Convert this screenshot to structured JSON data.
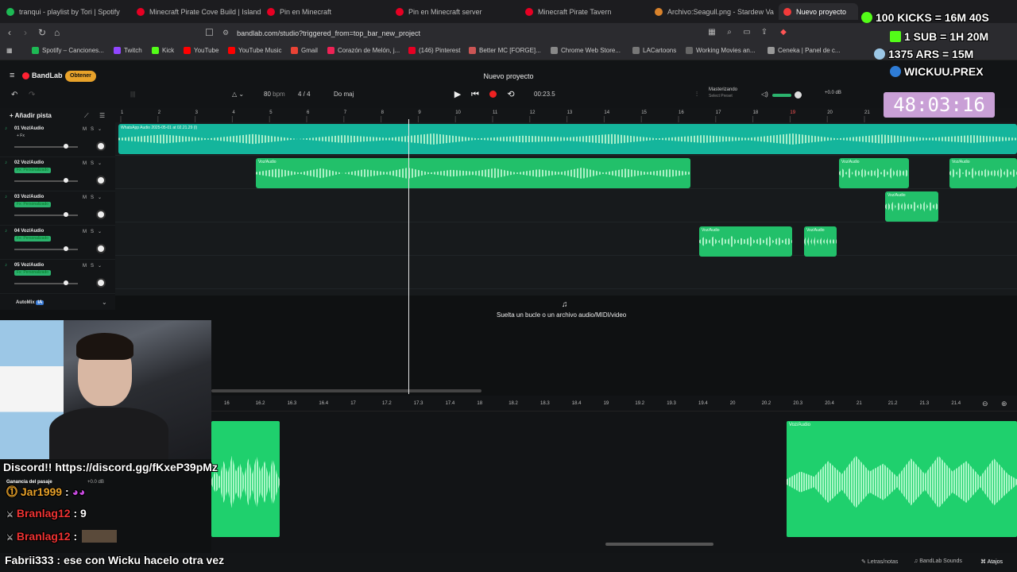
{
  "browser": {
    "tabs": [
      {
        "label": "tranqui - playlist by Tori | Spotify",
        "color": "#1db954"
      },
      {
        "label": "Minecraft Pirate Cove Build | Island",
        "color": "#e60023"
      },
      {
        "label": "Pin en Minecraft",
        "color": "#e60023"
      },
      {
        "label": "Pin en Minecraft server",
        "color": "#e60023"
      },
      {
        "label": "Minecraft Pirate Tavern",
        "color": "#e60023"
      },
      {
        "label": "Archivo:Seagull.png - Stardew Valley",
        "color": "#d9822b"
      },
      {
        "label": "Nuevo proyecto",
        "color": "#f23a3a"
      }
    ],
    "url": "bandlab.com/studio?triggered_from=top_bar_new_project",
    "bookmarks": [
      {
        "label": "Spotify – Canciones...",
        "color": "#1db954"
      },
      {
        "label": "Twitch",
        "color": "#9146ff"
      },
      {
        "label": "Kick",
        "color": "#53fc18"
      },
      {
        "label": "YouTube",
        "color": "#ff0000"
      },
      {
        "label": "YouTube Music",
        "color": "#ff0000"
      },
      {
        "label": "Gmail",
        "color": "#ea4335"
      },
      {
        "label": "Corazón de Melón, j...",
        "color": "#e25"
      },
      {
        "label": "(146) Pinterest",
        "color": "#e60023"
      },
      {
        "label": "Better MC [FORGE]...",
        "color": "#c55"
      },
      {
        "label": "Chrome Web Store...",
        "color": "#888"
      },
      {
        "label": "LACartoons",
        "color": "#777"
      },
      {
        "label": "Working Movies an...",
        "color": "#666"
      },
      {
        "label": "Ceneka | Panel de c...",
        "color": "#999"
      }
    ]
  },
  "studio": {
    "logo": "BandLab",
    "obtener": "Obtener",
    "project_title": "Nuevo proyecto",
    "bpm": "80",
    "bpm_unit": "bpm",
    "time_sig": "4 / 4",
    "key": "Do maj",
    "time": "00:23.5",
    "mastering_label": "Masterizando",
    "mastering_sub": "Select Preset",
    "db": "+0.0 dB",
    "add_track": "Añadir pista",
    "automix": "AutoMix",
    "drop_text": "Suelta un bucle o un archivo audio/MIDI/video",
    "ruler": [
      "1",
      "2",
      "3",
      "4",
      "5",
      "6",
      "7",
      "8",
      "9",
      "10",
      "11",
      "12",
      "13",
      "14",
      "15",
      "16",
      "17",
      "18",
      "19",
      "20",
      "21"
    ],
    "tracks": [
      {
        "num": "01",
        "name": "Voz/Audio",
        "fx": "+ Fx"
      },
      {
        "num": "02",
        "name": "Voz/Audio",
        "fx": "Fx: Personalizado"
      },
      {
        "num": "03",
        "name": "Voz/Audio",
        "fx": "Fx: Personalizado"
      },
      {
        "num": "04",
        "name": "Voz/Audio",
        "fx": "Fx: Personalizado"
      },
      {
        "num": "05",
        "name": "Voz/Audio",
        "fx": "Fx: Personalizado"
      }
    ],
    "clip_main_label": "WhatsApp Audio 2025-05-01 at 02.21.29 (l)",
    "clip_label": "Voz/Audio",
    "editor_ruler": [
      "16",
      "16.2",
      "16.3",
      "16.4",
      "17",
      "17.2",
      "17.3",
      "17.4",
      "18",
      "18.2",
      "18.3",
      "18.4",
      "19",
      "19.2",
      "19.3",
      "19.4",
      "20",
      "20.2",
      "20.3",
      "20.4",
      "21",
      "21.2",
      "21.3",
      "21.4"
    ],
    "footer": {
      "lyrics": "Letras/notas",
      "sounds": "BandLab Sounds",
      "shortcuts": "Atajos"
    }
  },
  "stream": {
    "goals": [
      "100 KICKS = 16M 40S",
      "1 SUB = 1H 20M",
      "1375 ARS = 15M",
      "WICKUU.PREX"
    ],
    "timer": "48:03:16",
    "discord": "Discord!! https://discord.gg/fKxeP39pMz",
    "ganancia": "Ganancia del pasaje",
    "ganancia_db": "+0.0 dB",
    "chat": [
      {
        "user": "Jar1999",
        "msg": ""
      },
      {
        "user": "Branlag12",
        "msg": "9"
      },
      {
        "user": "Branlag12",
        "msg": ""
      },
      {
        "user": "Fabrii333",
        "msg": "ese con Wicku hacelo otra vez"
      }
    ]
  }
}
